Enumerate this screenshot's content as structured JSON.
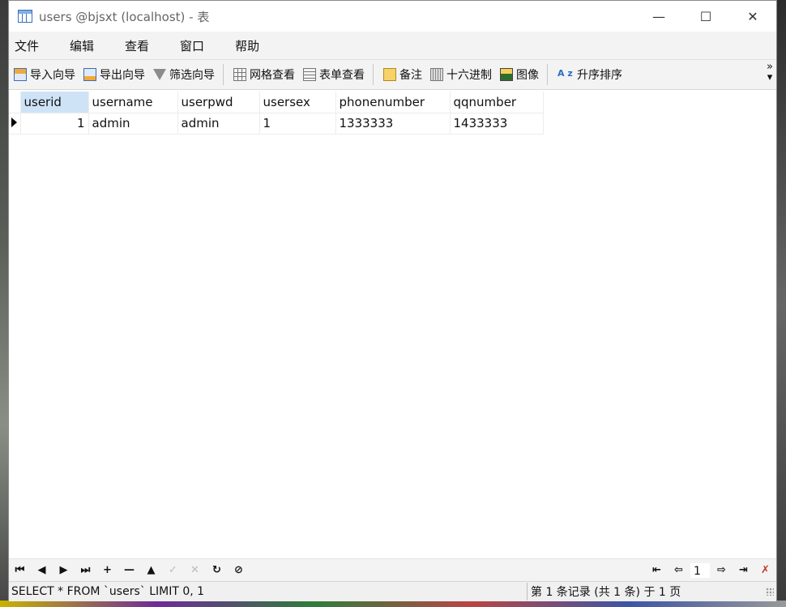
{
  "window": {
    "title": "users @bjsxt (localhost) - 表",
    "controls": {
      "minimize": "—",
      "maximize": "☐",
      "close": "✕"
    }
  },
  "menu": [
    "文件",
    "编辑",
    "查看",
    "窗口",
    "帮助"
  ],
  "toolbar": {
    "import_wizard": "导入向导",
    "export_wizard": "导出向导",
    "filter_wizard": "筛选向导",
    "grid_view": "网格查看",
    "form_view": "表单查看",
    "memo": "备注",
    "hex": "十六进制",
    "image": "图像",
    "sort_asc": "升序排序",
    "more": "»",
    "sort_icon_text": "A z"
  },
  "table": {
    "columns": [
      "userid",
      "username",
      "userpwd",
      "usersex",
      "phonenumber",
      "qqnumber"
    ],
    "rows": [
      [
        "1",
        "admin",
        "admin",
        "1",
        "1333333",
        "1433333"
      ]
    ]
  },
  "navigator": {
    "buttons": [
      "⏮",
      "◀",
      "▶",
      "⏭",
      "+",
      "—",
      "▲",
      "✓",
      "✕",
      "↻",
      "⊘"
    ],
    "page": "1"
  },
  "status": {
    "sql": "SELECT * FROM `users` LIMIT 0, 1",
    "records": "第 1 条记录 (共 1 条) 于 1 页"
  }
}
